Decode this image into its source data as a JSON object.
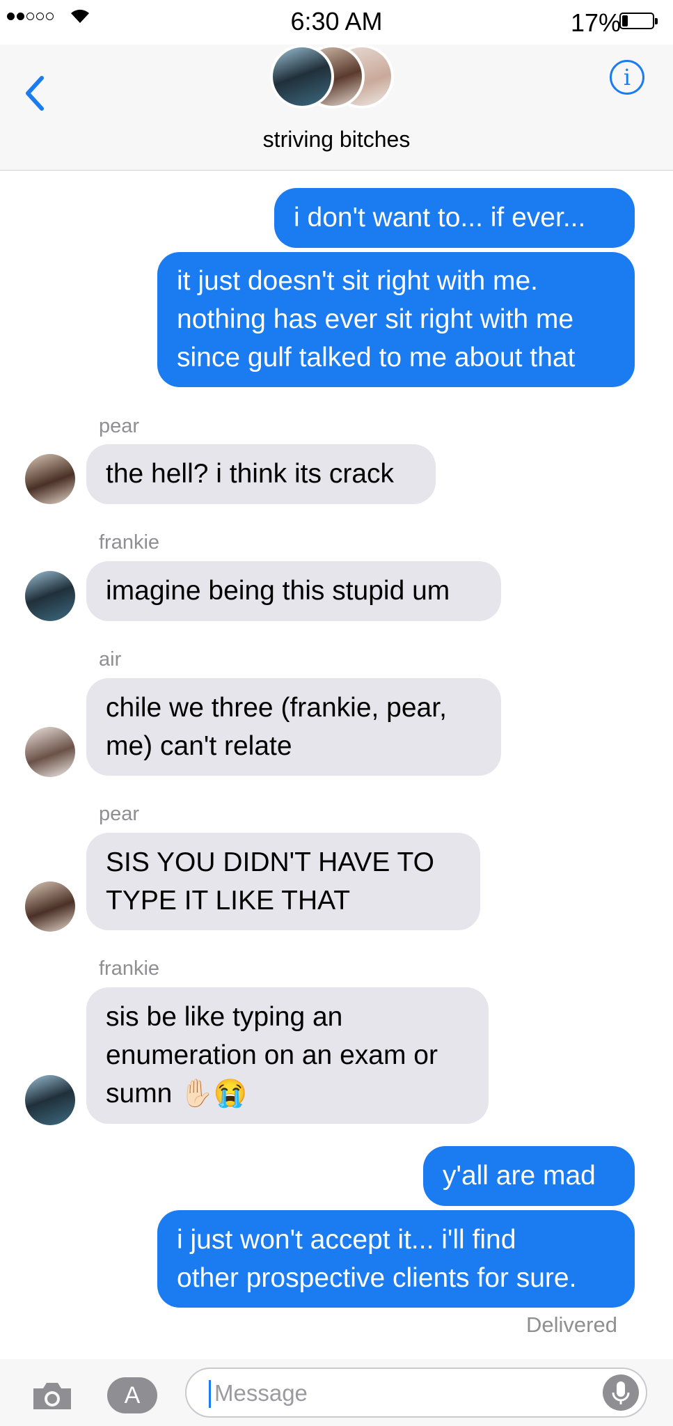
{
  "status_bar": {
    "time": "6:30 AM",
    "battery": "17%"
  },
  "header": {
    "title": "striving bitches"
  },
  "messages": [
    {
      "sender": "",
      "lines": [
        "i don't want to... if ever..."
      ]
    },
    {
      "sender": "",
      "lines": [
        "it just doesn't sit right with me.",
        "nothing has ever sit right with me",
        "since gulf talked to me about that"
      ]
    },
    {
      "sender": "pear",
      "lines": [
        "the hell? i think its crack"
      ]
    },
    {
      "sender": "frankie",
      "lines": [
        "imagine being this stupid um"
      ]
    },
    {
      "sender": "air",
      "lines": [
        "chile we three (frankie, pear,",
        "me) can't relate"
      ]
    },
    {
      "sender": "pear",
      "lines": [
        "SIS YOU DIDN'T HAVE TO",
        "TYPE IT LIKE THAT"
      ]
    },
    {
      "sender": "frankie",
      "lines": [
        "sis be like typing an",
        "enumeration on an exam or",
        "sumn ✋🏻😭"
      ]
    },
    {
      "sender": "",
      "lines": [
        "y'all are mad"
      ]
    },
    {
      "sender": "",
      "lines": [
        "i just won't accept it... i'll find",
        "other prospective clients for sure."
      ]
    }
  ],
  "status": {
    "delivered": "Delivered"
  },
  "composer": {
    "placeholder": "Message",
    "value": ""
  },
  "icons": [
    "wifi-icon",
    "battery-icon",
    "back-chevron-icon",
    "info-icon",
    "camera-icon",
    "app-store-icon",
    "mic-icon"
  ],
  "colors": {
    "accent": "#1a7cf0",
    "outgoing_bubble": "#1a7cf0",
    "incoming_bubble": "#e6e5eb",
    "muted_text": "#8e8e93"
  }
}
